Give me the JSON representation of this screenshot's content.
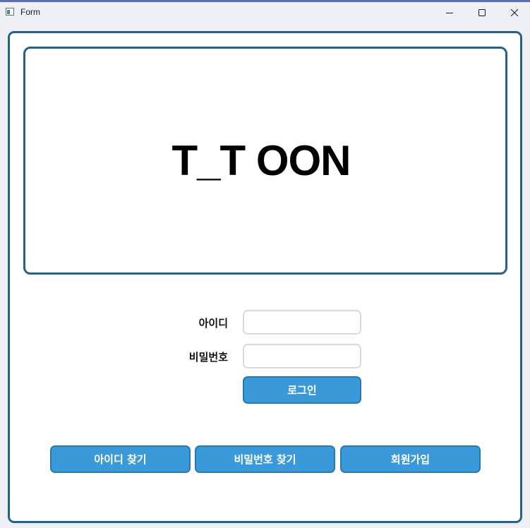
{
  "window": {
    "title": "Form",
    "icons": {
      "app": "app-icon",
      "minimize": "minimize-icon",
      "maximize": "maximize-icon",
      "close": "close-icon"
    }
  },
  "banner": {
    "logo_text": "T_T OON"
  },
  "login_form": {
    "id_label": "아이디",
    "id_value": "",
    "password_label": "비밀번호",
    "password_value": "",
    "login_button": "로그인"
  },
  "actions": {
    "find_id": "아이디 찾기",
    "find_password": "비밀번호 찾기",
    "signup": "회원가입"
  },
  "colors": {
    "border_accent": "#236390",
    "button_fill": "#3a9ad9",
    "button_border": "#2679b2",
    "window_background": "#eef0f6"
  }
}
